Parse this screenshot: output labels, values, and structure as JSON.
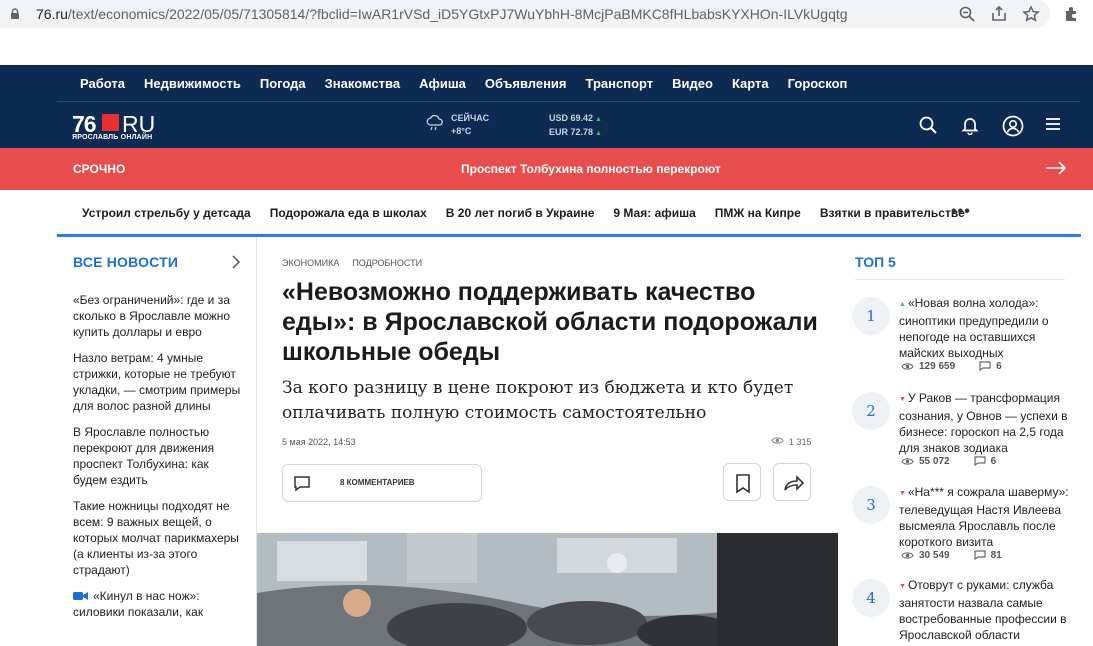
{
  "browser": {
    "url_host": "76.ru",
    "url_path": "/text/economics/2022/05/05/71305814/?fbclid=IwAR1rVSd_iD5YGtxPJ7WuYbhH-8McjPaBMKC8fHLbabsKYXHOn-ILVkUgqtg"
  },
  "topnav": {
    "links": [
      "Работа",
      "Недвижимость",
      "Погода",
      "Знакомства",
      "Афиша",
      "Объявления",
      "Транспорт",
      "Видео",
      "Карта",
      "Гороскоп"
    ]
  },
  "logo": {
    "num": "76",
    "ru": "RU",
    "sub": "ЯРОСЛАВЛЬ ОНЛАЙН"
  },
  "weather": {
    "label": "СЕЙЧАС",
    "temp": "+8°C"
  },
  "rates": {
    "usd": "USD 69.42",
    "eur": "EUR 72.78"
  },
  "breaking": {
    "label": "СРОЧНО",
    "title": "Проспект Толбухина полностью перекроют"
  },
  "tags": [
    "Устроил стрельбу у детсада",
    "Подорожала еда в школах",
    "В 20 лет погиб в Украине",
    "9 Мая: афиша",
    "ПМЖ на Кипре",
    "Взятки в правительстве"
  ],
  "tags_more": "•••",
  "left": {
    "title": "ВСЕ НОВОСТИ",
    "items": [
      "«Без ограничений»: где и за сколько в Ярославле можно купить доллары и евро",
      "Назло ветрам: 4 умные стрижки, которые не требуют укладки, — смотрим примеры для волос разной длины",
      "В Ярославле полностью перекроют для движения проспект Толбухина: как будем ездить",
      "Такие ножницы подходят не всем: 9 важных вещей, о которых молчат парикмахеры (а клиенты из-за этого страдают)",
      "«Кинул в нас нож»: силовики показали, как"
    ]
  },
  "article": {
    "rubric1": "ЭКОНОМИКА",
    "rubric2": "ПОДРОБНОСТИ",
    "headline": "«Невозможно поддерживать качество еды»: в Ярославской области подорожали школьные обеды",
    "subhead": "За кого разницу в цене покроют из бюджета и кто будет оплачивать полную стоимость самостоятельно",
    "date": "5 мая 2022, 14:53",
    "views": "1 315",
    "comments_label": "8 КОММЕНТАРИЕВ"
  },
  "top5": {
    "title": "ТОП 5",
    "items": [
      {
        "num": "1",
        "trend": "▲",
        "text": "«Новая волна холода»: синоптики предупредили о непогоде на оставшихся майских выходных",
        "views": "129 659",
        "comments": "6"
      },
      {
        "num": "2",
        "trend": "▼",
        "text": "У Раков — трансформация сознания, у Овнов — успехи в бизнесе: гороскоп на 2,5 года для знаков зодиака",
        "views": "55 072",
        "comments": "6"
      },
      {
        "num": "3",
        "trend": "▼",
        "text": "«На*** я сожрала шаверму»: телеведущая Настя Ивлеева высмеяла Ярославль после короткого визита",
        "views": "30 549",
        "comments": "81"
      },
      {
        "num": "4",
        "trend": "▼",
        "text": "Отоврут с руками: служба занятости назвала самые востребованные профессии в Ярославской области",
        "views": "",
        "comments": ""
      }
    ]
  },
  "colors": {
    "navy": "#0c2a52",
    "breaking": "#e84d4d",
    "accent": "#1f6fd1",
    "blue_line": "#2a7ee6"
  }
}
